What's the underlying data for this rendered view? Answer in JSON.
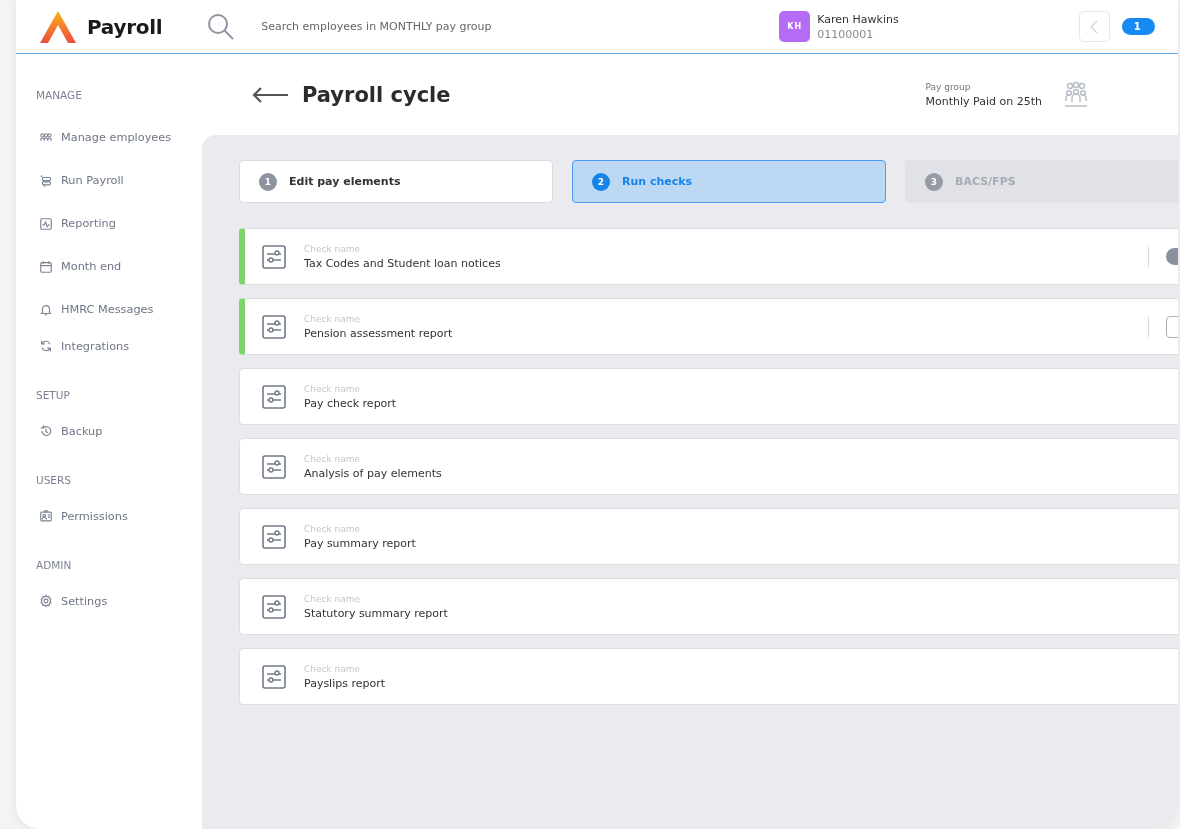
{
  "app": {
    "name": "Payroll"
  },
  "search": {
    "placeholder": "Search employees in MONTHLY pay group"
  },
  "user": {
    "initials": "KH",
    "name": "Karen Hawkins",
    "id": "01100001"
  },
  "badge": {
    "text": "1"
  },
  "sidebar": {
    "sections": [
      {
        "heading": "MANAGE",
        "items": [
          {
            "label": "Manage employees"
          },
          {
            "label": "Run Payroll"
          },
          {
            "label": "Reporting"
          },
          {
            "label": "Month end"
          },
          {
            "label": "HMRC Messages"
          },
          {
            "label": "Integrations"
          }
        ]
      },
      {
        "heading": "SETUP",
        "items": [
          {
            "label": "Backup"
          }
        ]
      },
      {
        "heading": "USERS",
        "items": [
          {
            "label": "Permissions"
          }
        ]
      },
      {
        "heading": "ADMIN",
        "items": [
          {
            "label": "Settings"
          }
        ]
      }
    ]
  },
  "page": {
    "title": "Payroll cycle",
    "pay_group": {
      "label": "Pay group",
      "value": "Monthly Paid on 25th"
    }
  },
  "steps": [
    {
      "number": "1",
      "label": "Edit pay elements",
      "selected": false,
      "disabled": false
    },
    {
      "number": "2",
      "label": "Run checks",
      "selected": true,
      "disabled": false
    },
    {
      "number": "3",
      "label": "BACS/FPS",
      "selected": false,
      "disabled": true
    }
  ],
  "checks": [
    {
      "caption": "Check name",
      "name": "Tax Codes and Student loan notices",
      "completed": true,
      "kind": "toggle"
    },
    {
      "caption": "Check name",
      "name": "Pension assessment report",
      "completed": true,
      "kind": "checkbox"
    },
    {
      "caption": "Check name",
      "name": "Pay check report",
      "completed": false,
      "kind": "none"
    },
    {
      "caption": "Check name",
      "name": "Analysis of pay elements",
      "completed": false,
      "kind": "none"
    },
    {
      "caption": "Check name",
      "name": "Pay summary report",
      "completed": false,
      "kind": "none"
    },
    {
      "caption": "Check name",
      "name": "Statutory summary report",
      "completed": false,
      "kind": "none"
    },
    {
      "caption": "Check name",
      "name": "Payslips report",
      "completed": false,
      "kind": "none"
    }
  ]
}
